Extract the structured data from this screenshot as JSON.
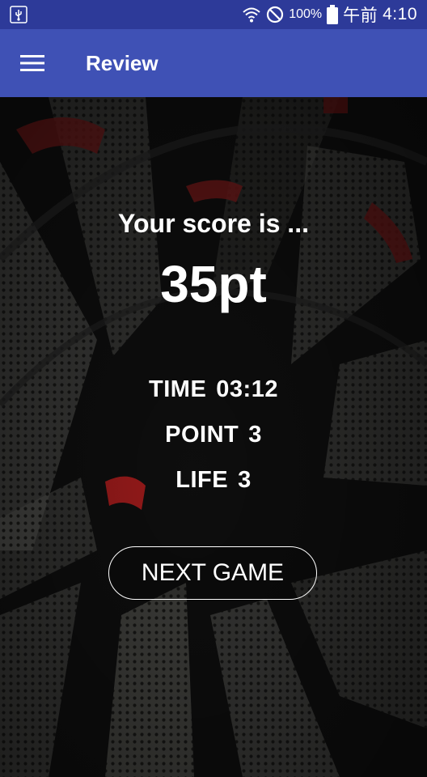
{
  "status_bar": {
    "usb_icon": "usb-icon",
    "wifi_icon": "wifi-icon",
    "dnd_icon": "do-not-disturb-icon",
    "battery_percent": "100%",
    "battery_icon": "battery-icon",
    "am_pm": "午前",
    "clock": "4:10"
  },
  "app_bar": {
    "menu_icon": "hamburger-menu-icon",
    "title": "Review"
  },
  "review": {
    "score_intro": "Your score is ...",
    "score_value": "35pt",
    "time_label": "TIME",
    "time_value": "03:12",
    "point_label": "POINT",
    "point_value": "3",
    "life_label": "LIFE",
    "life_value": "3",
    "next_button_label": "NEXT GAME"
  },
  "colors": {
    "status_bar": "#2d3a99",
    "app_bar": "#3f51b5",
    "text": "#ffffff"
  }
}
